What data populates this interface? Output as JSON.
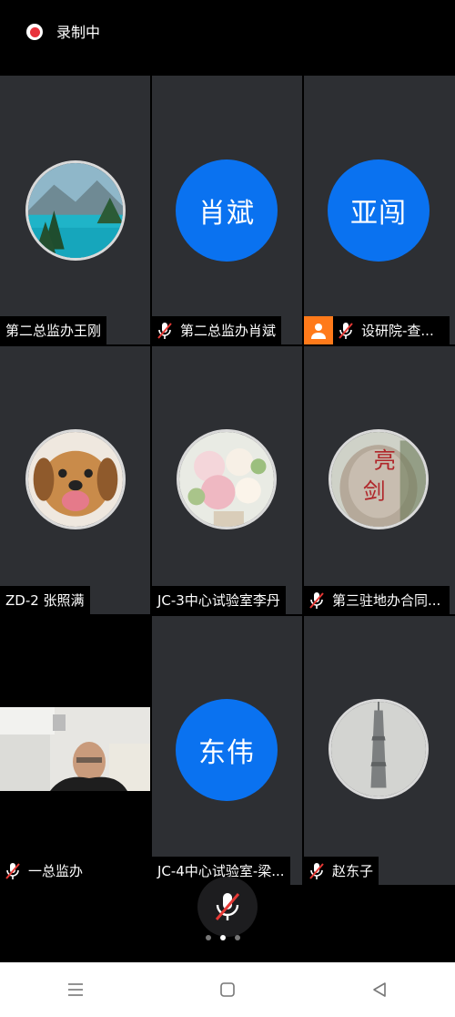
{
  "recording": {
    "label": "录制中",
    "indicator_color": "#e8323c"
  },
  "participants": [
    {
      "name": "第二总监办王刚",
      "avatar": "lake-photo-icon",
      "muted": false
    },
    {
      "name": "第二总监办肖斌",
      "avatar_text": "肖斌",
      "muted": true
    },
    {
      "name": "设研院-查...",
      "avatar_text": "亚闯",
      "muted": true,
      "host": true
    },
    {
      "name": "ZD-2 张照满",
      "avatar": "dog-photo-icon",
      "muted": false
    },
    {
      "name": "JC-3中心试验室李丹",
      "avatar": "flower-photo-icon",
      "muted": false
    },
    {
      "name": "第三驻地办合同...",
      "avatar": "rock-calligraphy-photo-icon",
      "avatar_glyphs": "亮剑",
      "muted": true
    },
    {
      "name": "一总监办",
      "video": true,
      "muted": true
    },
    {
      "name": "JC-4中心试验室-梁...",
      "avatar_text": "东伟",
      "muted": false
    },
    {
      "name": "赵东子",
      "avatar": "tower-photo-icon",
      "muted": true
    }
  ],
  "colors": {
    "tile_bg": "#2d2f33",
    "avatar_blue": "#0a72f0",
    "host_orange": "#ff7a1a",
    "mute_red": "#e53935"
  },
  "pager": {
    "pages": 3,
    "active": 2
  },
  "nav": {
    "buttons": [
      "menu-icon",
      "home-icon",
      "back-icon"
    ]
  }
}
